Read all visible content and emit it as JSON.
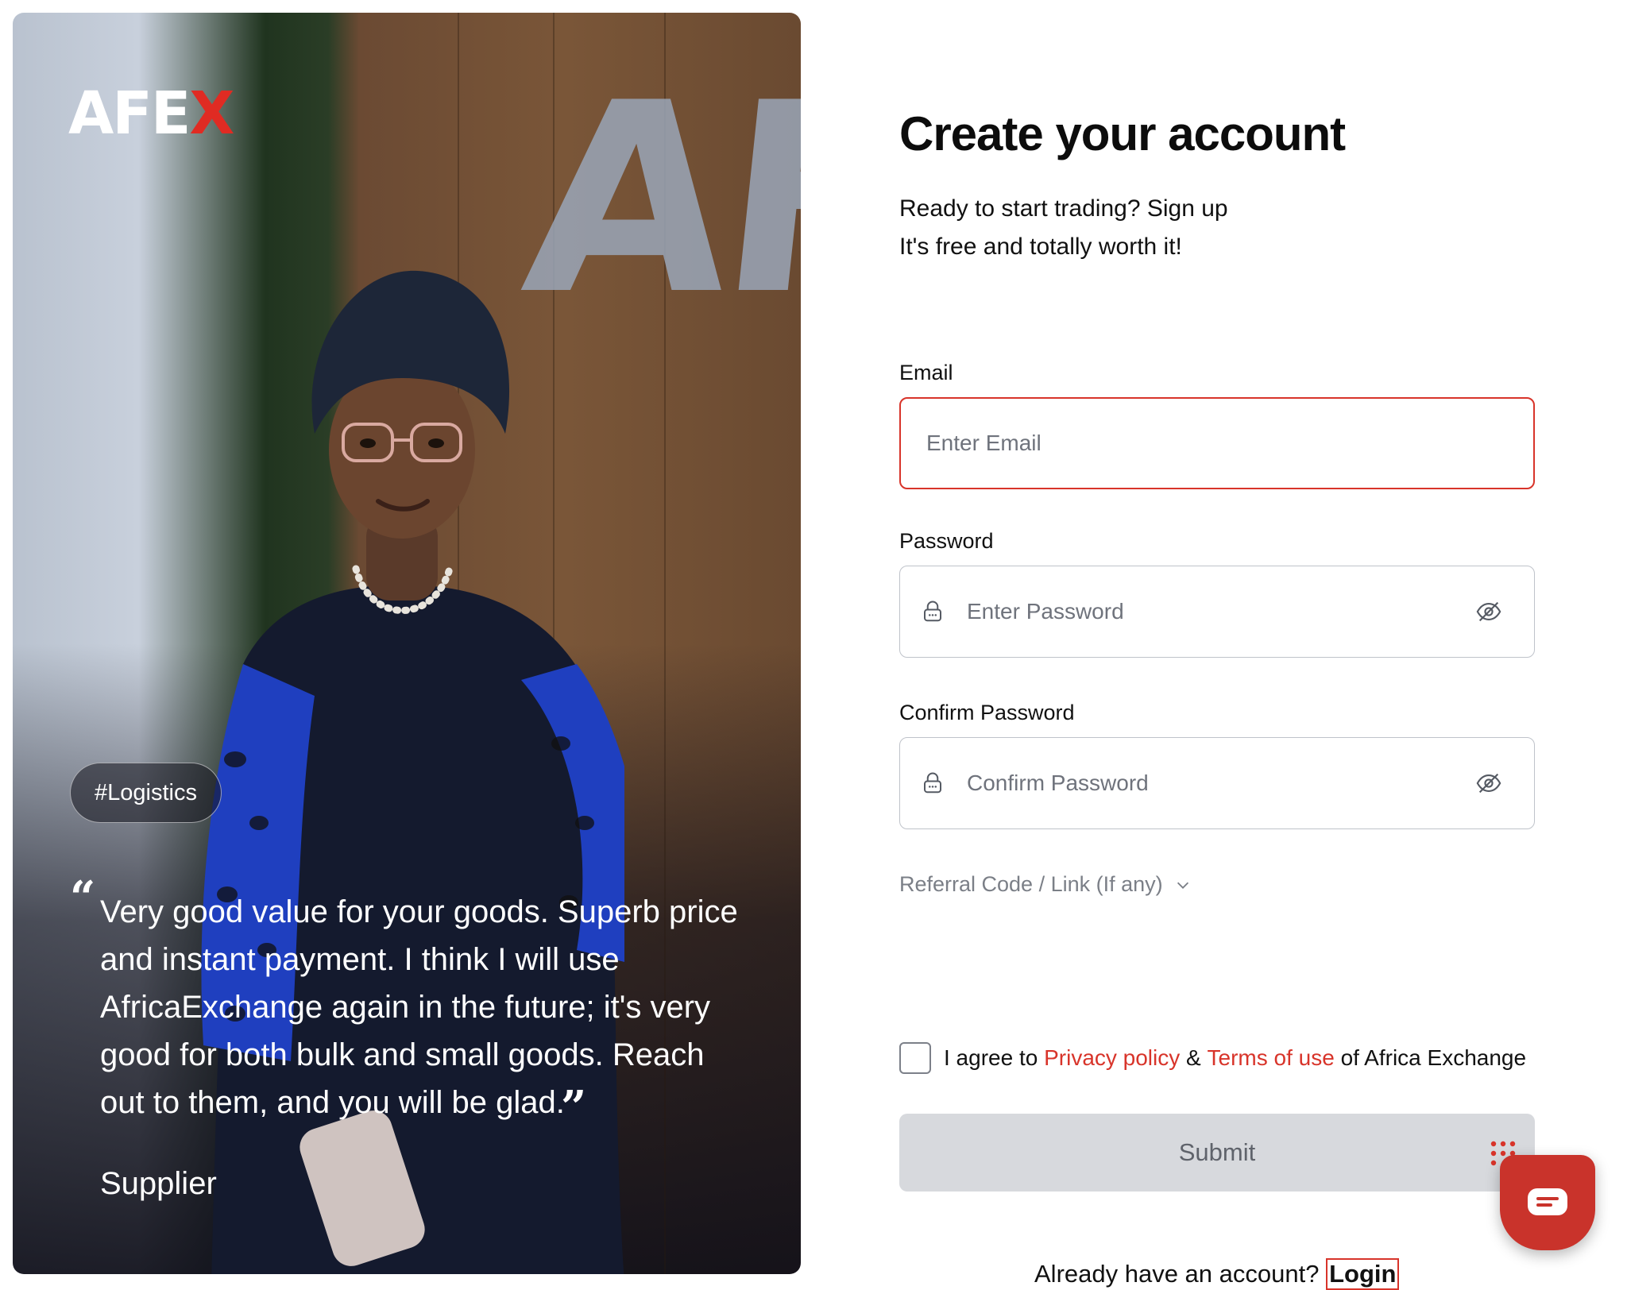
{
  "brand": {
    "logo_main": "AFE",
    "logo_accent": "X",
    "accent_color": "#d8342a"
  },
  "hero": {
    "tag": "#Logistics",
    "quote": "Very good value for your goods. Superb price and instant payment. I think I will use AfricaExchange again in the future; it's very good for both bulk and small goods. Reach out to them, and you will be glad.",
    "role": "Supplier",
    "open_quote": "“",
    "close_quote": "”"
  },
  "form": {
    "title": "Create your account",
    "subtitle_1": "Ready to start trading? Sign up",
    "subtitle_2": "It's free and totally worth it!",
    "email": {
      "label": "Email",
      "placeholder": "Enter Email",
      "value": ""
    },
    "password": {
      "label": "Password",
      "placeholder": "Enter Password",
      "value": "",
      "lead_icon": "lock-icon",
      "trail_icon": "eye-off-icon"
    },
    "confirm_password": {
      "label": "Confirm Password",
      "placeholder": "Confirm Password",
      "value": "",
      "lead_icon": "lock-icon",
      "trail_icon": "eye-off-icon"
    },
    "referral_label": "Referral Code / Link (If any)",
    "agree": {
      "prefix": "I agree to",
      "privacy": "Privacy policy",
      "amp": "&",
      "terms": "Terms of use",
      "suffix": "of Africa Exchange",
      "checked": false
    },
    "submit_label": "Submit",
    "login_prompt": "Already have an account?",
    "login_link": "Login"
  },
  "chat": {
    "icon": "chat-bubble-icon"
  }
}
